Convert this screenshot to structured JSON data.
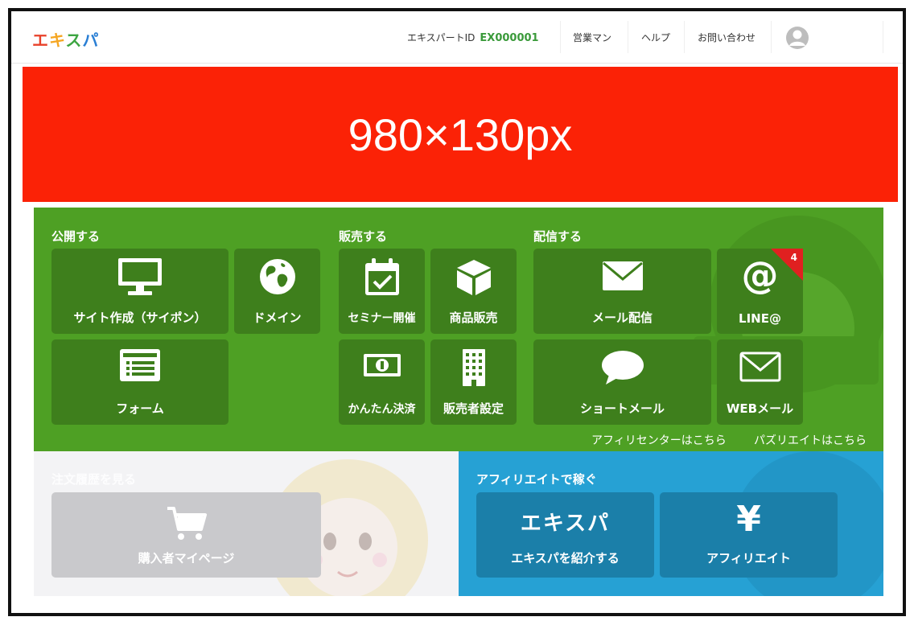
{
  "header": {
    "logo": [
      "エ",
      "キ",
      "ス",
      "パ"
    ],
    "id_label": "エキスパートID",
    "id_value": "EX000001",
    "links": [
      "営業マン",
      "ヘルプ",
      "お問い合わせ"
    ]
  },
  "banner": {
    "text": "980×130px"
  },
  "sections": {
    "publish": "公開する",
    "sell": "販売する",
    "deliver": "配信する"
  },
  "tiles": {
    "site": "サイト作成（サイポン）",
    "domain": "ドメイン",
    "form": "フォーム",
    "seminar": "セミナー開催",
    "product": "商品販売",
    "payment": "かんたん決済",
    "seller": "販売者設定",
    "mail": "メール配信",
    "line": "LINE@",
    "line_badge": "4",
    "short_mail": "ショートメール",
    "web_mail": "WEBメール"
  },
  "links": {
    "affiliate_center": "アフィリセンターはこちら",
    "puzzle_rate": "パズリエイトはこちら"
  },
  "orders": {
    "title": "注文履歴を見る",
    "mypage": "購入者マイページ"
  },
  "affiliate": {
    "title": "アフィリエイトで稼ぐ",
    "logo_text": "エキスパ",
    "introduce": "エキスパを紹介する",
    "affiliate_symbol": "¥",
    "affiliate_label": "アフィリエイト"
  }
}
